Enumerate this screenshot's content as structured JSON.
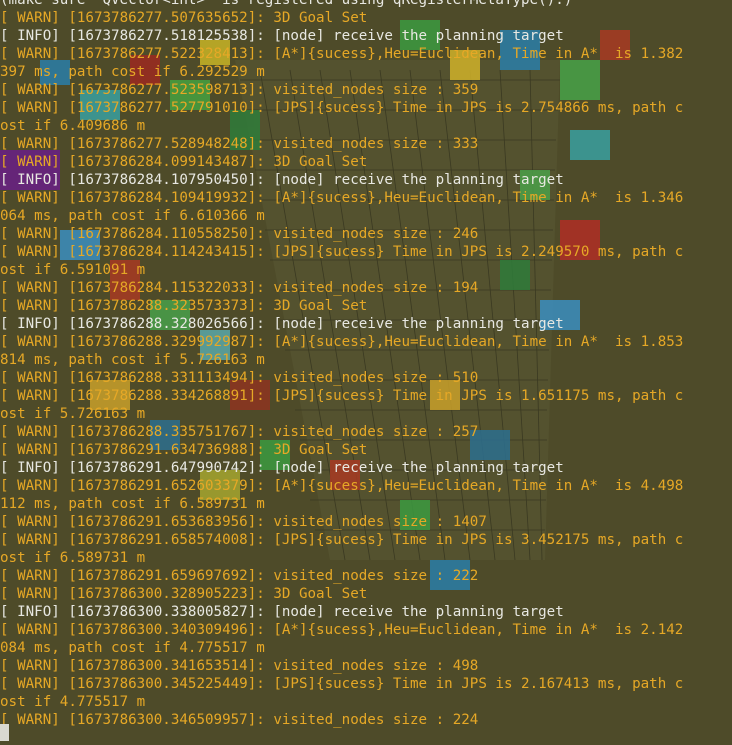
{
  "terminal": {
    "lines": [
      {
        "level": "plain",
        "text": "(make sure 'QVector<int>' is registered using qRegisterMetaType().)"
      },
      {
        "level": "warn",
        "text": "[ WARN] [1673786277.507635652]: 3D Goal Set"
      },
      {
        "level": "info",
        "text": "[ INFO] [1673786277.518125538]: [node] receive the planning target"
      },
      {
        "level": "warn",
        "text": "[ WARN] [1673786277.522328413]: [A*]{sucess},Heu=Euclidean, Time in A*  is 1.382"
      },
      {
        "level": "warn",
        "text": "397 ms, path cost if 6.292529 m"
      },
      {
        "level": "warn",
        "text": "[ WARN] [1673786277.523598713]: visited_nodes size : 359"
      },
      {
        "level": "warn",
        "text": "[ WARN] [1673786277.527791010]: [JPS]{sucess} Time in JPS is 2.754866 ms, path c"
      },
      {
        "level": "warn",
        "text": "ost if 6.409686 m"
      },
      {
        "level": "warn",
        "text": "[ WARN] [1673786277.528948248]: visited_nodes size : 333"
      },
      {
        "level": "warn",
        "text": "[ WARN] [1673786284.099143487]: 3D Goal Set"
      },
      {
        "level": "info",
        "text": "[ INFO] [1673786284.107950450]: [node] receive the planning target"
      },
      {
        "level": "warn",
        "text": "[ WARN] [1673786284.109419932]: [A*]{sucess},Heu=Euclidean, Time in A*  is 1.346"
      },
      {
        "level": "warn",
        "text": "064 ms, path cost if 6.610366 m"
      },
      {
        "level": "warn",
        "text": "[ WARN] [1673786284.110558250]: visited_nodes size : 246"
      },
      {
        "level": "warn",
        "text": "[ WARN] [1673786284.114243415]: [JPS]{sucess} Time in JPS is 2.249570 ms, path c"
      },
      {
        "level": "warn",
        "text": "ost if 6.591091 m"
      },
      {
        "level": "warn",
        "text": "[ WARN] [1673786284.115322033]: visited_nodes size : 194"
      },
      {
        "level": "warn",
        "text": "[ WARN] [1673786288.323573373]: 3D Goal Set"
      },
      {
        "level": "info",
        "text": "[ INFO] [1673786288.328026566]: [node] receive the planning target"
      },
      {
        "level": "warn",
        "text": "[ WARN] [1673786288.329992987]: [A*]{sucess},Heu=Euclidean, Time in A*  is 1.853"
      },
      {
        "level": "warn",
        "text": "814 ms, path cost if 5.726163 m"
      },
      {
        "level": "warn",
        "text": "[ WARN] [1673786288.331113494]: visited_nodes size : 510"
      },
      {
        "level": "warn",
        "text": "[ WARN] [1673786288.334268891]: [JPS]{sucess} Time in JPS is 1.651175 ms, path c"
      },
      {
        "level": "warn",
        "text": "ost if 5.726163 m"
      },
      {
        "level": "warn",
        "text": "[ WARN] [1673786288.335751767]: visited_nodes size : 257"
      },
      {
        "level": "warn",
        "text": "[ WARN] [1673786291.634736988]: 3D Goal Set"
      },
      {
        "level": "info",
        "text": "[ INFO] [1673786291.647990742]: [node] receive the planning target"
      },
      {
        "level": "warn",
        "text": "[ WARN] [1673786291.652603379]: [A*]{sucess},Heu=Euclidean, Time in A*  is 4.498"
      },
      {
        "level": "warn",
        "text": "112 ms, path cost if 6.589731 m"
      },
      {
        "level": "warn",
        "text": "[ WARN] [1673786291.653683956]: visited_nodes size : 1407"
      },
      {
        "level": "warn",
        "text": "[ WARN] [1673786291.658574008]: [JPS]{sucess} Time in JPS is 3.452175 ms, path c"
      },
      {
        "level": "warn",
        "text": "ost if 6.589731 m"
      },
      {
        "level": "warn",
        "text": "[ WARN] [1673786291.659697692]: visited_nodes size : 222"
      },
      {
        "level": "warn",
        "text": "[ WARN] [1673786300.328905223]: 3D Goal Set"
      },
      {
        "level": "info",
        "text": "[ INFO] [1673786300.338005827]: [node] receive the planning target"
      },
      {
        "level": "warn",
        "text": "[ WARN] [1673786300.340309496]: [A*]{sucess},Heu=Euclidean, Time in A*  is 2.142"
      },
      {
        "level": "warn",
        "text": "084 ms, path cost if 4.775517 m"
      },
      {
        "level": "warn",
        "text": "[ WARN] [1673786300.341653514]: visited_nodes size : 498"
      },
      {
        "level": "warn",
        "text": "[ WARN] [1673786300.345225449]: [JPS]{sucess} Time in JPS is 2.167413 ms, path c"
      },
      {
        "level": "warn",
        "text": "ost if 4.775517 m"
      },
      {
        "level": "warn",
        "text": "[ WARN] [1673786300.346509957]: visited_nodes size : 224"
      }
    ]
  },
  "colors": {
    "background": "#4e4b29",
    "warn_text": "#e6a826",
    "info_text": "#e8e8e2",
    "cursor": "#d9d9d0"
  },
  "icons": {
    "cursor": "block-cursor-icon"
  }
}
